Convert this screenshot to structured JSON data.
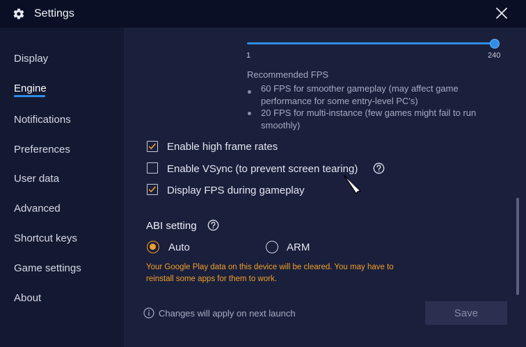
{
  "window": {
    "title": "Settings"
  },
  "sidebar": {
    "items": [
      {
        "label": "Display"
      },
      {
        "label": "Engine",
        "active": true
      },
      {
        "label": "Notifications"
      },
      {
        "label": "Preferences"
      },
      {
        "label": "User data"
      },
      {
        "label": "Advanced"
      },
      {
        "label": "Shortcut keys"
      },
      {
        "label": "Game settings"
      },
      {
        "label": "About"
      }
    ]
  },
  "engine": {
    "fps_slider": {
      "min_label": "1",
      "max_label": "240",
      "value": 240
    },
    "recommended": {
      "title": "Recommended FPS",
      "items": [
        "60 FPS for smoother gameplay (may affect game performance for some entry-level PC's)",
        "20 FPS for multi-instance (few games might fail to run smoothly)"
      ]
    },
    "options": [
      {
        "label": "Enable high frame rates",
        "checked": true
      },
      {
        "label": "Enable VSync (to prevent screen tearing)",
        "checked": false
      },
      {
        "label": "Display FPS during gameplay",
        "checked": true
      }
    ],
    "abi": {
      "title": "ABI setting",
      "options": [
        {
          "label": "Auto",
          "selected": true
        },
        {
          "label": "ARM",
          "selected": false
        }
      ],
      "warning": "Your Google Play data on this device will be cleared. You may have to reinstall some apps for them to work."
    },
    "footer_note": "Changes will apply on next launch",
    "save_label": "Save"
  },
  "colors": {
    "accent": "#2f8de8",
    "warning": "#f0a028",
    "background": "#1a1f3c",
    "titlebar": "#0b0f26"
  },
  "icons": [
    "gear-icon",
    "close-icon",
    "help-icon",
    "info-icon",
    "check-icon",
    "pointer-cursor-icon"
  ]
}
